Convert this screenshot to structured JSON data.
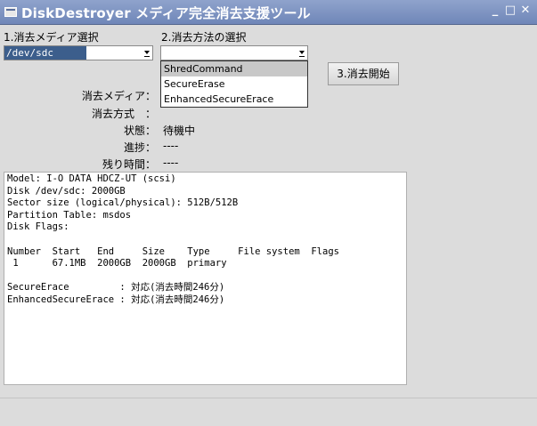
{
  "window": {
    "title": "DiskDestroyer メディア完全消去支援ツール",
    "controls": [
      "minimize-icon",
      "maximize-icon",
      "close-icon"
    ]
  },
  "step1": {
    "label": "1.消去メディア選択",
    "selected": "/dev/sdc"
  },
  "step2": {
    "label": "2.消去方法の選択",
    "selected": "",
    "options": [
      "ShredCommand",
      "SecureErase",
      "EnhancedSecureErace"
    ],
    "highlighted": "ShredCommand"
  },
  "start_button": "3.消去開始",
  "info": {
    "media_label": "消去メディア：",
    "media_value": "",
    "method_label": "消去方式　：",
    "method_value": "",
    "status_label": "状態：",
    "status_value": "待機中",
    "progress_label": "進捗：",
    "progress_value": "----",
    "remaining_label": "残り時間：",
    "remaining_value": "----"
  },
  "console": {
    "lines": [
      "Model: I-O DATA HDCZ-UT (scsi)",
      "Disk /dev/sdc: 2000GB",
      "Sector size (logical/physical): 512B/512B",
      "Partition Table: msdos",
      "Disk Flags:",
      "",
      "Number  Start   End     Size    Type     File system  Flags",
      " 1      67.1MB  2000GB  2000GB  primary",
      "",
      "SecureErace         : 対応(消去時間246分)",
      "EnhancedSecureErace : 対応(消去時間246分)"
    ]
  },
  "colors": {
    "titlebar": "#7f94c4",
    "selection": "#3c5e8c",
    "window_bg": "#dcdcdc"
  }
}
